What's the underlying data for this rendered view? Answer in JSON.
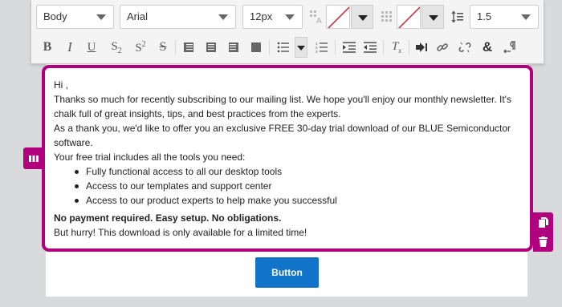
{
  "toolbar": {
    "block_format": "Body",
    "font_family": "Arial",
    "font_size": "12px",
    "line_height": "1.5"
  },
  "content": {
    "greeting": "Hi ,",
    "para1": "Thanks so much for recently subscribing to our mailing list. We hope you'll enjoy our monthly newsletter. It's chalk full of great insights, tips, and best practices from the experts.",
    "para2": "As a thank you, we'd like to offer you an exclusive FREE 30-day trial download of our BLUE Semiconductor software.",
    "para3": "Your free trial includes all the tools you need:",
    "bullets": [
      "Fully functional access to all our desktop tools",
      "Access to our templates and support center",
      "Access to our product experts to help make you successful"
    ],
    "bold_line": "No payment required. Easy setup. No obligations.",
    "closing": "But hurry! This download is only available for a limited time!"
  },
  "cta": {
    "label": "Button"
  },
  "colors": {
    "accent": "#b0007d",
    "button": "#1174c9"
  }
}
